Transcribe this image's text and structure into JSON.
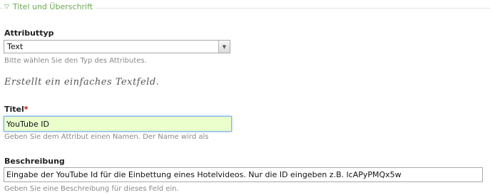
{
  "fieldset": {
    "legend": "Titel und Überschrift",
    "toggle_glyph": "▽"
  },
  "attribute_type": {
    "label": "Attributtyp",
    "selected": "Text",
    "arrow_glyph": "▼",
    "description": "Bitte wählen Sie den Typ des Attributes."
  },
  "type_note": "Erstellt ein einfaches Textfeld.",
  "title_field": {
    "label": "Titel",
    "required_mark": "*",
    "value": "YouTube ID",
    "description": "Geben Sie dem Attribut einen Namen. Der Name wird als"
  },
  "description_field": {
    "label": "Beschreibung",
    "value": "Eingabe der YouTube Id für die Einbettung eines Hotelvideos. Nur die ID eingeben z.B. lcAPyPMQx5w",
    "description": "Geben Sie eine Beschreibung für dieses Feld ein."
  },
  "colors": {
    "legend": "#6aa84f",
    "required": "#cc0000",
    "focused_input_bg": "#eaffcc",
    "focus_border": "#7fb2e6"
  }
}
